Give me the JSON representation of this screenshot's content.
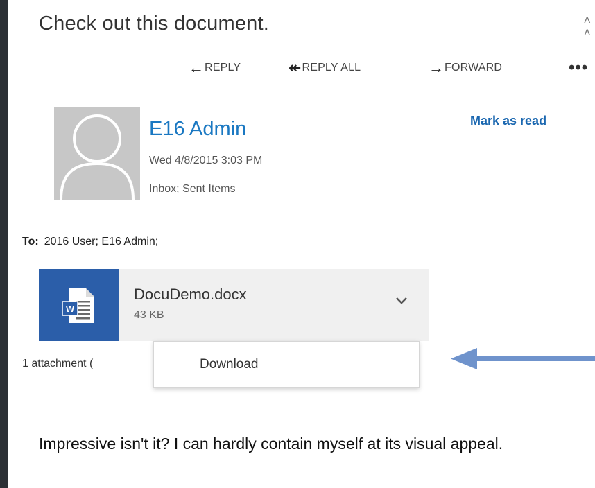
{
  "message": {
    "subject": "Check out this document.",
    "actions": {
      "reply": "REPLY",
      "reply_all": "REPLY ALL",
      "forward": "FORWARD",
      "more": "•••"
    },
    "sender": {
      "name": "E16 Admin",
      "date": "Wed 4/8/2015 3:03 PM",
      "folders": "Inbox; Sent Items"
    },
    "mark_as_read": "Mark as read",
    "to_label": "To:",
    "recipients": "2016 User;  E16 Admin;",
    "attachment": {
      "name": "DocuDemo.docx",
      "size": "43 KB",
      "icon_letter": "W"
    },
    "attachment_count": "1 attachment (",
    "menu": {
      "download": "Download"
    },
    "body_text": "Impressive isn't it? I can hardly contain myself at its visual appeal."
  },
  "colors": {
    "accent": "#1a78c2",
    "word_blue": "#2b5ea9",
    "arrow": "#6f93cc",
    "background": "#2b3035"
  },
  "icons": [
    "collapse-icon",
    "reply-arrow-icon",
    "reply-all-arrow-icon",
    "forward-arrow-icon",
    "avatar-placeholder-icon",
    "word-document-icon",
    "chevron-down-icon",
    "callout-arrow-icon"
  ]
}
